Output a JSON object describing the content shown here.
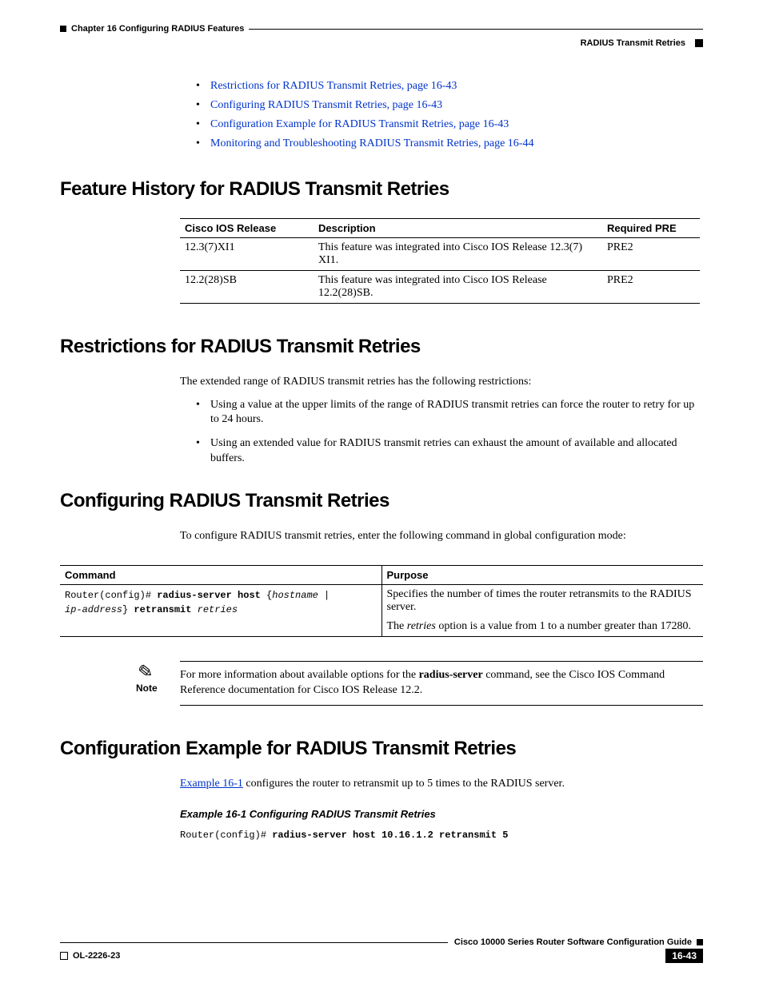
{
  "header": {
    "chapter": "Chapter 16    Configuring RADIUS Features",
    "section": "RADIUS Transmit Retries"
  },
  "toc": [
    "Restrictions for RADIUS Transmit Retries, page 16-43",
    "Configuring RADIUS Transmit Retries, page 16-43",
    "Configuration Example for RADIUS Transmit Retries, page 16-43",
    "Monitoring and Troubleshooting RADIUS Transmit Retries, page 16-44"
  ],
  "sections": {
    "feature_history": {
      "heading": "Feature History for RADIUS Transmit Retries",
      "table": {
        "headers": [
          "Cisco IOS Release",
          "Description",
          "Required PRE"
        ],
        "rows": [
          [
            "12.3(7)XI1",
            "This feature was integrated into Cisco IOS Release 12.3(7) XI1.",
            "PRE2"
          ],
          [
            "12.2(28)SB",
            "This feature was integrated into Cisco IOS Release 12.2(28)SB.",
            "PRE2"
          ]
        ]
      }
    },
    "restrictions": {
      "heading": "Restrictions for RADIUS Transmit Retries",
      "intro": "The extended range of RADIUS transmit retries has the following restrictions:",
      "bullets": [
        "Using a value at the upper limits of the range of RADIUS transmit retries can force the router to retry for up to 24 hours.",
        "Using an extended value for RADIUS transmit retries can exhaust the amount of available and allocated buffers."
      ]
    },
    "configuring": {
      "heading": "Configuring RADIUS Transmit Retries",
      "intro": "To configure RADIUS transmit retries, enter the following command in global configuration mode:",
      "table": {
        "headers": [
          "Command",
          "Purpose"
        ],
        "command_prefix": "Router(config)# ",
        "command_bold1": "radius-server host",
        "command_mid": " {",
        "command_it1": "hostname",
        "command_pipe": " | ",
        "command_it2": "ip-address",
        "command_mid2": "} ",
        "command_bold2": "retransmit",
        "command_it3": " retries",
        "purpose_p1": "Specifies the number of times the router retransmits to the RADIUS server.",
        "purpose_p2_a": "The ",
        "purpose_p2_it": "retries",
        "purpose_p2_b": " option is a value from 1 to a number greater than 17280."
      },
      "note": {
        "label": "Note",
        "text_a": "For more information about available options for the ",
        "text_bold": "radius-server",
        "text_b": " command, see the Cisco IOS Command Reference documentation for Cisco IOS Release 12.2."
      }
    },
    "example": {
      "heading": "Configuration Example for RADIUS Transmit Retries",
      "intro_link": "Example 16-1",
      "intro_rest": " configures the router to retransmit up to 5 times to the RADIUS server.",
      "caption": "Example 16-1   Configuring RADIUS Transmit Retries",
      "code_prefix": "Router(config)# ",
      "code_bold": "radius-server host 10.16.1.2 retransmit 5"
    }
  },
  "footer": {
    "guide": "Cisco 10000 Series Router Software Configuration Guide",
    "doc": "OL-2226-23",
    "page": "16-43"
  }
}
